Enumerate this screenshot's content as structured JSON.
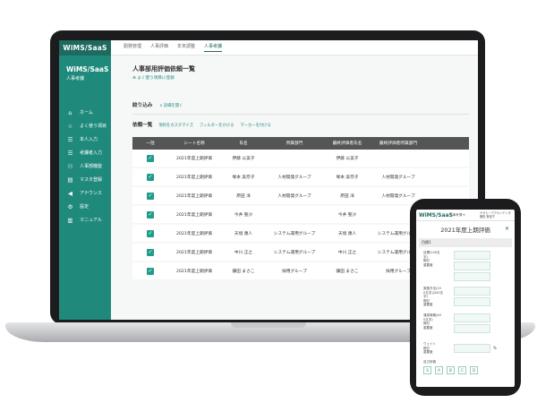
{
  "laptop": {
    "topbar": {
      "logo": "WiMS/SaaS",
      "nav": [
        "勤務管理",
        "人事評価",
        "年末調整",
        "人事考課"
      ]
    },
    "sidebar": {
      "brand": "WiMS/SaaS",
      "subtitle": "人事考課",
      "items": [
        {
          "label": "ホーム",
          "icon": "home-icon"
        },
        {
          "label": "よく使う項目",
          "icon": "star-icon"
        },
        {
          "label": "本人入力",
          "icon": "list-icon"
        },
        {
          "label": "考課者入力",
          "icon": "list-icon"
        },
        {
          "label": "人事部機能",
          "icon": "people-icon"
        },
        {
          "label": "マスタ登録",
          "icon": "database-icon"
        },
        {
          "label": "アナウンス",
          "icon": "megaphone-icon"
        },
        {
          "label": "設定",
          "icon": "gear-icon"
        },
        {
          "label": "マニュアル",
          "icon": "book-icon"
        }
      ]
    },
    "main": {
      "title": "人事部用評価依頼一覧",
      "favorite": "よく使う項目に登録",
      "filter": "絞り込み",
      "filter_toggle": "詳細を開く",
      "list_title": "依頼一覧",
      "links": [
        "項目をカスタマイズ",
        "フィルターをかける",
        "マーカーを付ける"
      ],
      "columns": [
        "一括",
        "シート名称",
        "氏名",
        "所属部門",
        "最終評価者氏名",
        "最終評価者所属部門"
      ],
      "rows": [
        {
          "checked": true,
          "sheet": "2021年度上期評価",
          "name": "伊藤 公美子",
          "dept": "",
          "final_name": "伊藤 公美子",
          "final_dept": ""
        },
        {
          "checked": true,
          "sheet": "2021年度上期評価",
          "name": "塚本 美奈子",
          "dept": "人材開発グループ",
          "final_name": "塚本 美奈子",
          "final_dept": "人材開発グループ"
        },
        {
          "checked": true,
          "sheet": "2021年度上期評価",
          "name": "原田 洋",
          "dept": "人材開発グループ",
          "final_name": "原田 洋",
          "final_dept": "人材開発グループ"
        },
        {
          "checked": true,
          "sheet": "2021年度上期評価",
          "name": "今井 聖沙",
          "dept": "",
          "final_name": "今井 聖沙",
          "final_dept": ""
        },
        {
          "checked": true,
          "sheet": "2021年度上期評価",
          "name": "天境 康人",
          "dept": "システム運用グループ",
          "final_name": "天境 康人",
          "final_dept": "システム運用グループ"
        },
        {
          "checked": true,
          "sheet": "2021年度上期評価",
          "name": "中川 正之",
          "dept": "システム運用グループ",
          "final_name": "中川 正之",
          "final_dept": "システム運用グループ"
        },
        {
          "checked": true,
          "sheet": "2021年度上期評価",
          "name": "鎌田 まさこ",
          "dept": "採用グループ",
          "final_name": "鎌田 まさこ",
          "final_dept": "採用グループ"
        }
      ]
    }
  },
  "phone": {
    "logo": "WiMS/SaaS",
    "dropdown": "人事考課 ▾",
    "user_line1": "ササヒーアクセンテンダ",
    "user_line2": "鎌田 美保子",
    "title": "2021年度上期評価",
    "section": "目標1",
    "field_labels": [
      [
        "目標(100文",
        "字)",
        "期日",
        "重要度"
      ],
      [
        "実施方法(15",
        "0文字)(200文",
        "字)",
        "期日",
        "重要度"
      ],
      [
        "達成時期(40",
        "0文字)",
        "期日",
        "重要度"
      ],
      [
        "ウェイト",
        "期日",
        "重要度"
      ]
    ],
    "percent": "%",
    "self_eval": "自己評価",
    "grades": [
      "S",
      "A",
      "B",
      "C",
      "D"
    ]
  },
  "colors": {
    "brand": "#1f8a7c",
    "brand_dark": "#1f6a5f",
    "header": "#555555"
  }
}
